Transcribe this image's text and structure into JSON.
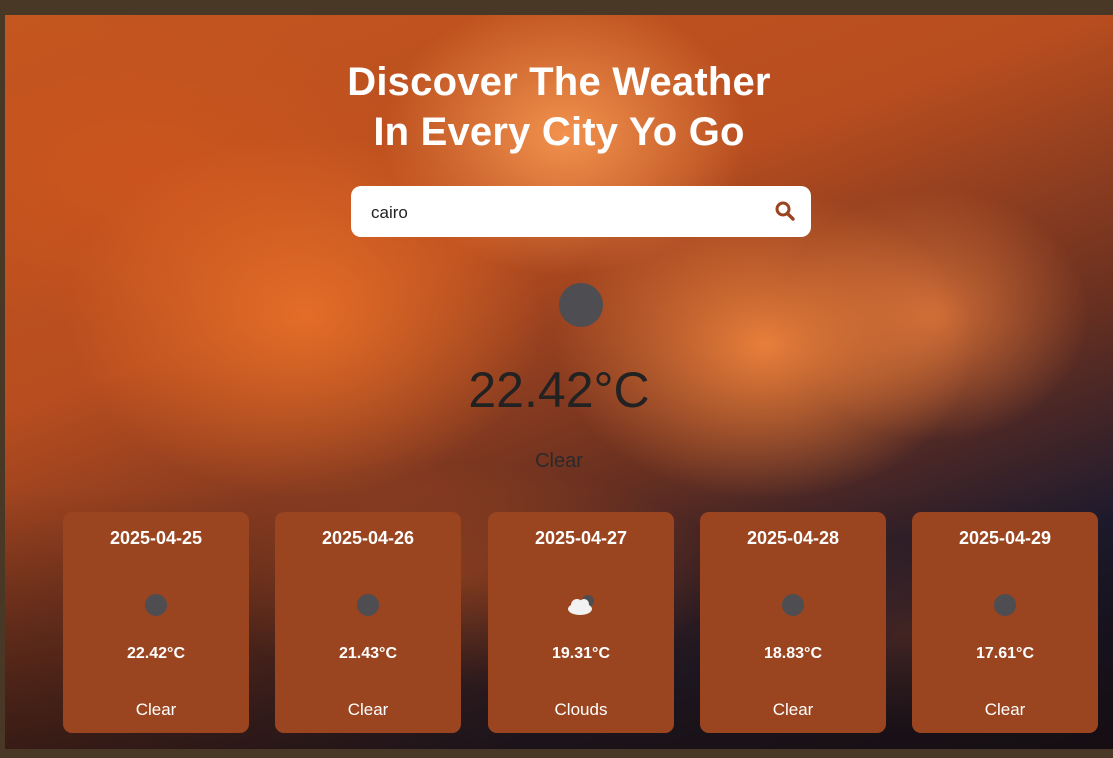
{
  "header": {
    "title_line1": "Discover The Weather",
    "title_line2": "In Every City Yo Go"
  },
  "search": {
    "value": "cairo",
    "icon": "search-icon",
    "icon_color": "#9a4520"
  },
  "current": {
    "icon": "clear-icon",
    "temp": "22.42°C",
    "description": "Clear"
  },
  "forecast": [
    {
      "date": "2025-04-25",
      "icon": "clear-icon",
      "temp": "22.42°C",
      "description": "Clear"
    },
    {
      "date": "2025-04-26",
      "icon": "clear-icon",
      "temp": "21.43°C",
      "description": "Clear"
    },
    {
      "date": "2025-04-27",
      "icon": "cloud-icon",
      "temp": "19.31°C",
      "description": "Clouds"
    },
    {
      "date": "2025-04-28",
      "icon": "clear-icon",
      "temp": "18.83°C",
      "description": "Clear"
    },
    {
      "date": "2025-04-29",
      "icon": "clear-icon",
      "temp": "17.61°C",
      "description": "Clear"
    }
  ],
  "colors": {
    "card_background": "#9a4520",
    "search_background": "#ffffff",
    "title_text": "#ffffff",
    "temp_text": "#222222"
  }
}
